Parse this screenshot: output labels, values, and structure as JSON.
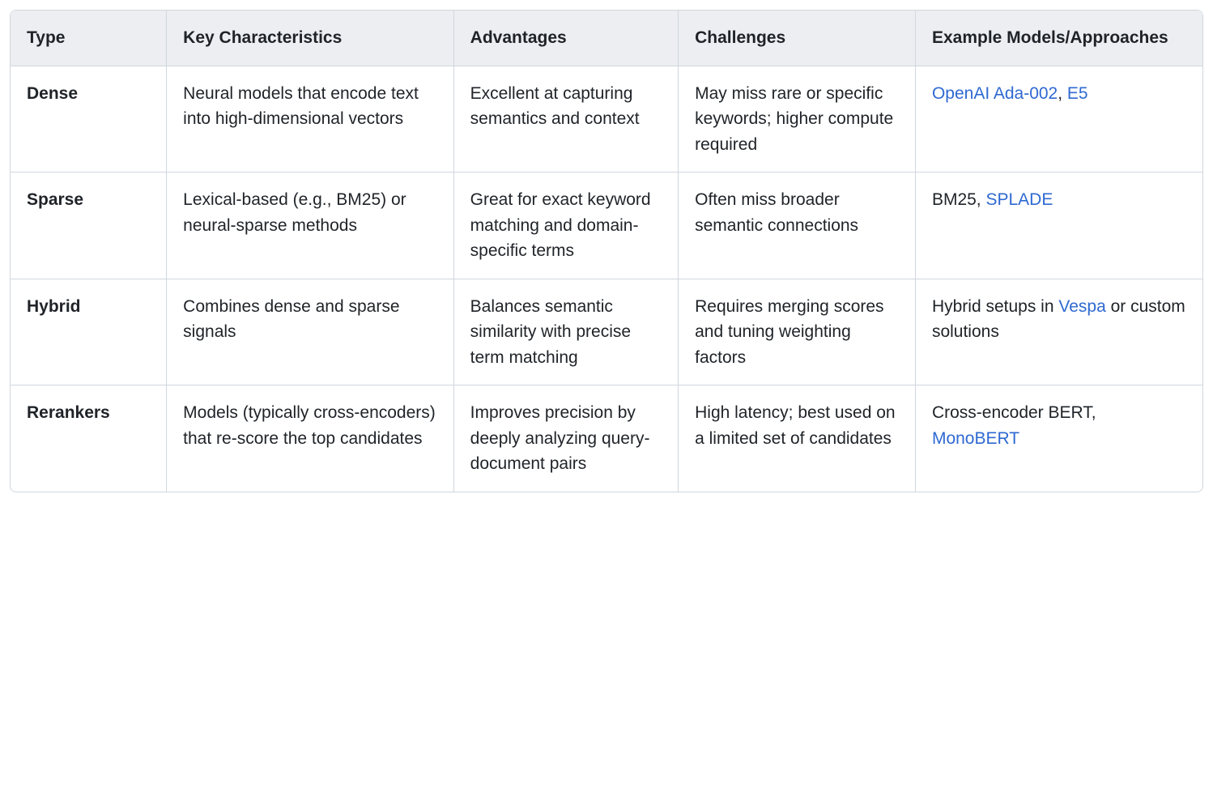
{
  "table": {
    "headers": {
      "type": "Type",
      "key": "Key Characteristics",
      "adv": "Advantages",
      "cha": "Challenges",
      "ex": "Example Models/Approaches"
    },
    "rows": [
      {
        "type": "Dense",
        "key": "Neural models that encode text into high-dimensional vectors",
        "adv": "Excellent at capturing semantics and context",
        "cha": "May miss rare or specific keywords; higher compute required",
        "ex_parts": [
          {
            "text": "OpenAI Ada-002",
            "link": true
          },
          {
            "text": ", ",
            "link": false
          },
          {
            "text": "E5",
            "link": true
          }
        ]
      },
      {
        "type": "Sparse",
        "key": "Lexical-based (e.g., BM25) or neural-sparse methods",
        "adv": "Great for exact keyword matching and domain-specific terms",
        "cha": "Often miss broader semantic connections",
        "ex_parts": [
          {
            "text": "BM25, ",
            "link": false
          },
          {
            "text": "SPLADE",
            "link": true
          }
        ]
      },
      {
        "type": "Hybrid",
        "key": "Combines dense and sparse signals",
        "adv": "Balances semantic similarity with precise term matching",
        "cha": "Requires merging scores and tuning weighting factors",
        "ex_parts": [
          {
            "text": "Hybrid setups in ",
            "link": false
          },
          {
            "text": "Vespa",
            "link": true
          },
          {
            "text": " or custom solutions",
            "link": false
          }
        ]
      },
      {
        "type": "Rerankers",
        "key": "Models (typically cross-encoders) that re-score the top candidates",
        "adv": "Improves precision by deeply analyzing query-document pairs",
        "cha": "High latency; best used on a limited set of candidates",
        "ex_parts": [
          {
            "text": "Cross-encoder BERT, ",
            "link": false
          },
          {
            "text": "MonoBERT",
            "link": true
          }
        ]
      }
    ]
  }
}
